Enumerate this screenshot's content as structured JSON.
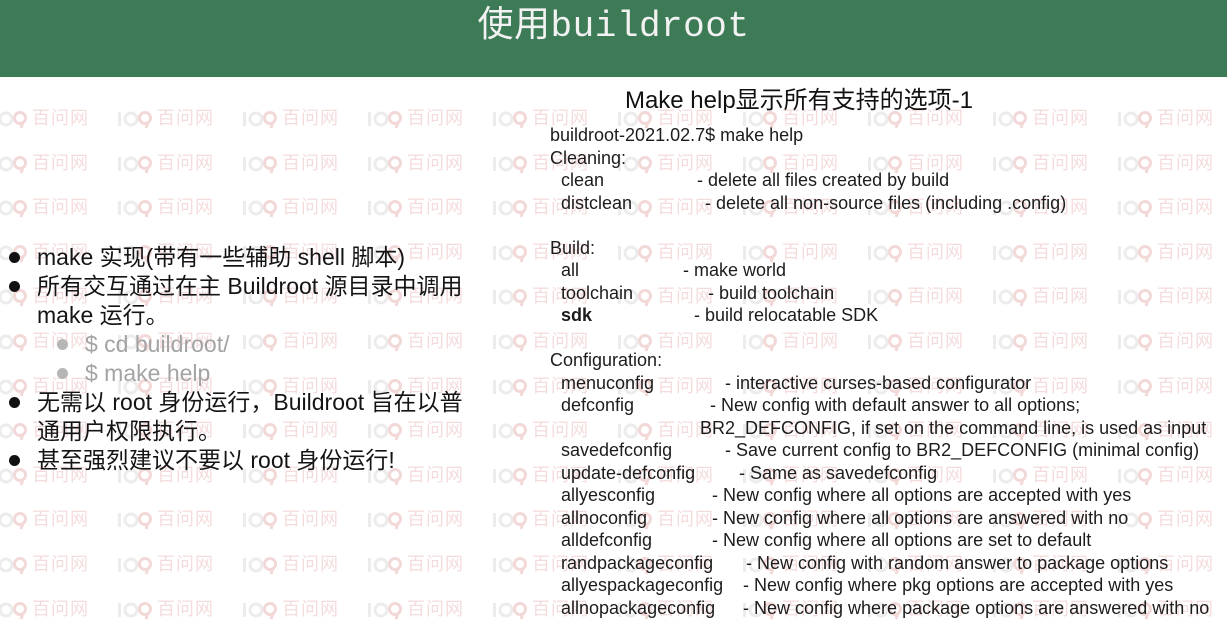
{
  "slide": {
    "title": "使用buildroot",
    "watermark_text": "百问网"
  },
  "colors": {
    "header": "#3d7a56",
    "title_text": "#f2f2f2",
    "sub_bullet_text": "#a3a3a3"
  },
  "bullets": [
    {
      "lines": [
        "make 实现(带有一些辅助 shell 脚本)"
      ]
    },
    {
      "lines": [
        "所有交互通过在主 Buildroot 源目录中调用",
        "make 运行。"
      ],
      "sub": [
        "$ cd buildroot/",
        "$ make help"
      ]
    },
    {
      "lines": [
        "无需以 root 身份运行，Buildroot 旨在以普",
        "通用户权限执行。"
      ]
    },
    {
      "lines": [
        "甚至强烈建议不要以 root 身份运行!"
      ]
    }
  ],
  "help": {
    "heading": "Make help显示所有支持的选项-1",
    "prompt": "buildroot-2021.02.7$ make help",
    "sections": [
      {
        "title": "Cleaning:",
        "items": [
          {
            "name": "clean",
            "desc": "- delete all files created by build"
          },
          {
            "name": "distclean",
            "desc": "- delete all non-source files (including .config)"
          }
        ]
      },
      {
        "title": "Build:",
        "items": [
          {
            "name": "all",
            "desc": "- make world"
          },
          {
            "name": "toolchain",
            "desc": "- build toolchain"
          },
          {
            "name": "sdk",
            "desc": "- build relocatable SDK",
            "bold": true
          }
        ]
      },
      {
        "title": "Configuration:",
        "items": [
          {
            "name": "menuconfig",
            "desc": "- interactive curses-based configurator"
          },
          {
            "name": "defconfig",
            "desc": "- New config with default answer to all options;",
            "desc_cont": "BR2_DEFCONFIG, if set on the command line, is used as input"
          },
          {
            "name": "savedefconfig",
            "desc": "- Save current config to BR2_DEFCONFIG (minimal config)"
          },
          {
            "name": "update-defconfig",
            "desc": "- Same as savedefconfig"
          },
          {
            "name": "allyesconfig",
            "desc": "- New config where all options are accepted with yes"
          },
          {
            "name": "allnoconfig",
            "desc": "- New config where all options are answered with no"
          },
          {
            "name": "alldefconfig",
            "desc": "- New config where all options are set to default"
          },
          {
            "name": "randpackageconfig",
            "desc": "- New config with random answer to package options"
          },
          {
            "name": "allyespackageconfig",
            "desc": "- New config where pkg options are accepted with yes"
          },
          {
            "name": "allnopackageconfig",
            "desc": "- New config where package options are answered with no"
          }
        ]
      }
    ]
  }
}
